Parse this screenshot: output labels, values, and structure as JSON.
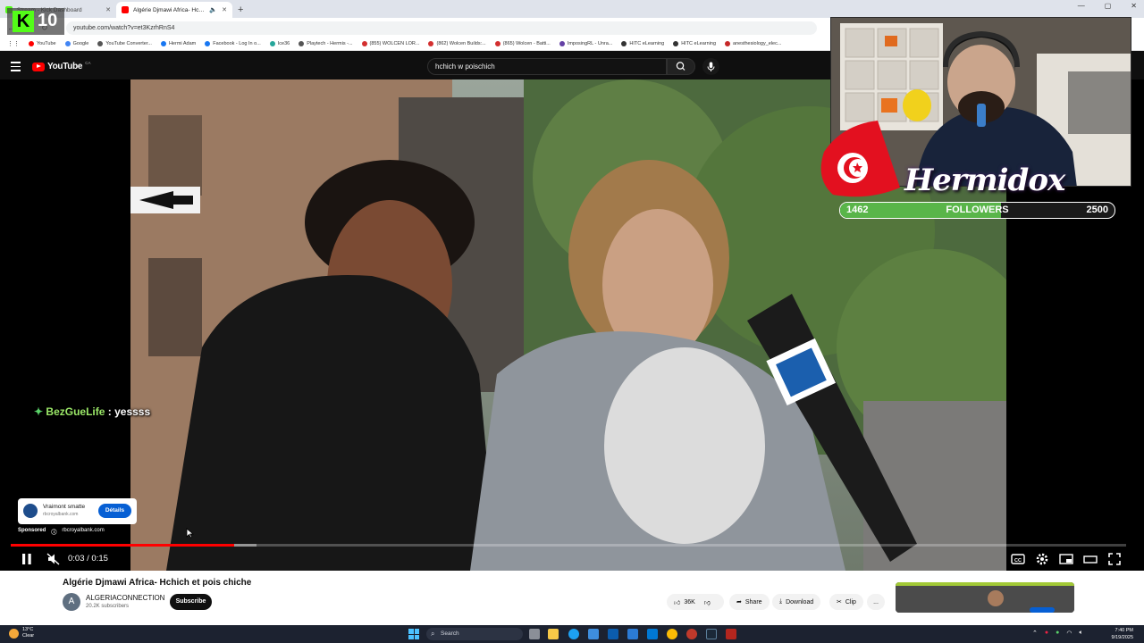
{
  "browser": {
    "tabs": [
      {
        "title": "Stream - Kick Dashboard",
        "active": false,
        "favicon_color": "#53fc18"
      },
      {
        "title": "Algérie Djmawi Africa- Hchich et pois chiche",
        "active": true,
        "favicon_color": "#ff0000"
      }
    ],
    "new_tab": "+",
    "url": "youtube.com/watch?v=et3KzrhRnS4",
    "bookmarks": [
      {
        "label": "YouTube",
        "color": "#ff0000"
      },
      {
        "label": "Google",
        "color": "#4285f4"
      },
      {
        "label": "YouTube Converter...",
        "color": "#555555"
      },
      {
        "label": "Hermi Adam",
        "color": "#1877f2"
      },
      {
        "label": "Facebook - Log In o...",
        "color": "#1877f2"
      },
      {
        "label": "Ice36",
        "color": "#26a69a"
      },
      {
        "label": "Playtech - Hermis -...",
        "color": "#555555"
      },
      {
        "label": "(855) WOLCEN LOR...",
        "color": "#d32f2f"
      },
      {
        "label": "(862) Wolcen Builds:...",
        "color": "#d32f2f"
      },
      {
        "label": "(865) Wolcen - Batti...",
        "color": "#d32f2f"
      },
      {
        "label": "ImposingRL - Unra...",
        "color": "#6441a5"
      },
      {
        "label": "HITC eLearning",
        "color": "#333333"
      },
      {
        "label": "HITC eLearning",
        "color": "#333333"
      },
      {
        "label": "anesthesiology_elec...",
        "color": "#c62828"
      }
    ]
  },
  "youtube": {
    "logo_text": "YouTube",
    "region": "CA",
    "search_query": "hchich w poischich",
    "player": {
      "current_time": "0:03",
      "duration": "0:15",
      "time_display": "0:03 / 0:15",
      "progress_fraction": 0.2,
      "muted": true,
      "playing": true
    },
    "ad": {
      "title": "Vraimont smatte",
      "domain": "rbcroyalbank.com",
      "button": "Détails",
      "sponsored_label": "Sponsored",
      "sponsored_domain": "rbcroyalbank.com"
    },
    "video": {
      "title": "Algérie Djmawi Africa- Hchich et pois chiche",
      "channel": "ALGERIACONNECTION",
      "channel_initial": "A",
      "subscribers": "20.2K subscribers",
      "subscribe_label": "Subscribe",
      "likes": "36K",
      "share_label": "Share",
      "download_label": "Download",
      "clip_label": "Clip",
      "more_label": "..."
    }
  },
  "stream_overlay": {
    "kick_count": "10",
    "kick_letter": "K",
    "chat": {
      "user": "BezGueLife",
      "separator": " : ",
      "message": "yessss"
    },
    "streamer_name": "Hermidox",
    "followers": {
      "current": "1462",
      "label": "FOLLOWERS",
      "goal": "2500",
      "fraction": 0.585
    }
  },
  "taskbar": {
    "weather_temp": "13°C",
    "weather_desc": "Clear",
    "search_placeholder": "Search",
    "time": "7:40 PM",
    "date": "9/19/2025"
  }
}
